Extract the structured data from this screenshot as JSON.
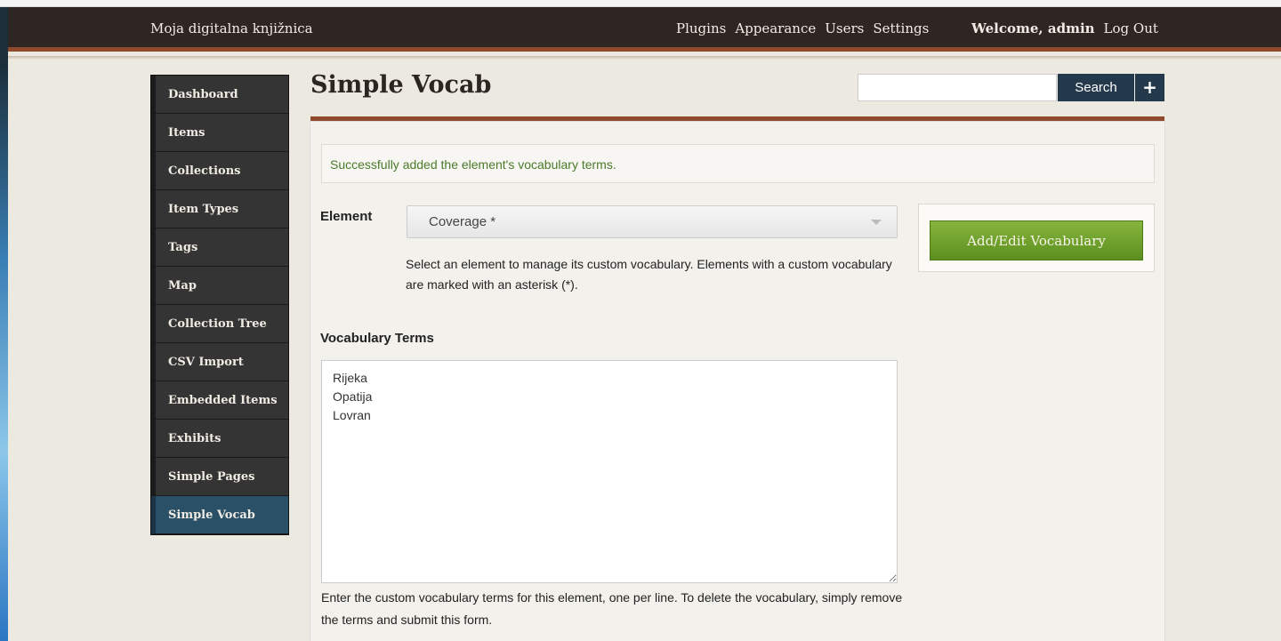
{
  "header": {
    "site_title": "Moja digitalna knjižnica",
    "nav": [
      "Plugins",
      "Appearance",
      "Users",
      "Settings"
    ],
    "welcome": "Welcome, admin",
    "logout": "Log Out"
  },
  "sidebar": {
    "items": [
      {
        "label": "Dashboard"
      },
      {
        "label": "Items"
      },
      {
        "label": "Collections"
      },
      {
        "label": "Item Types"
      },
      {
        "label": "Tags"
      },
      {
        "label": "Map"
      },
      {
        "label": "Collection Tree"
      },
      {
        "label": "CSV Import"
      },
      {
        "label": "Embedded Items"
      },
      {
        "label": "Exhibits"
      },
      {
        "label": "Simple Pages"
      },
      {
        "label": "Simple Vocab"
      }
    ],
    "active": "Simple Vocab"
  },
  "page": {
    "title": "Simple Vocab"
  },
  "search": {
    "value": "",
    "button_label": "Search",
    "advanced_label": "+"
  },
  "flash": {
    "message": "Successfully added the element's vocabulary terms."
  },
  "form": {
    "element_label": "Element",
    "element_selected": "Coverage *",
    "element_help": "Select an element to manage its custom vocabulary. Elements with a custom vocabulary are marked with an asterisk (*).",
    "terms_label": "Vocabulary Terms",
    "terms_value": "Rijeka\nOpatija\nLovran",
    "terms_help": "Enter the custom vocabulary terms for this element, one per line. To delete the vocabulary, simply remove the terms and submit this form."
  },
  "save": {
    "button_label": "Add/Edit Vocabulary"
  },
  "colors": {
    "header_bg": "#2e2622",
    "accent_rule": "#8f4a2e",
    "sidebar_active": "#2a5068",
    "search_button": "#24394c",
    "save_button": "#6fa12b",
    "flash_text": "#4a7a2a"
  }
}
